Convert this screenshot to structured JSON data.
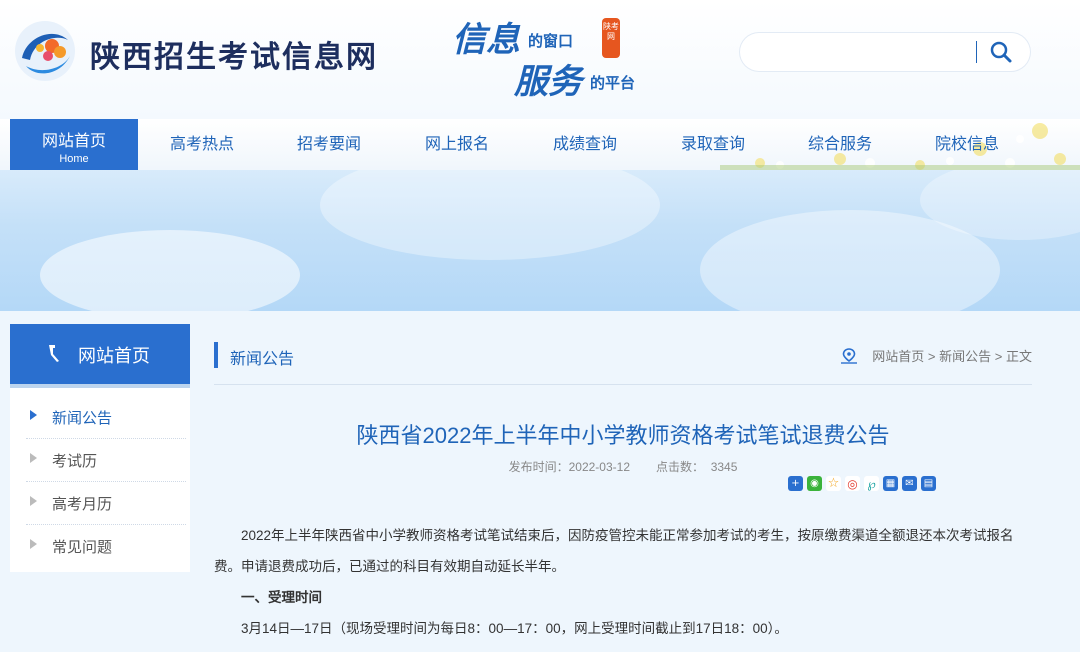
{
  "header": {
    "site_name": "陕西招生考试信息网",
    "slogan": {
      "big1": "信息",
      "small1": "的窗口",
      "big2": "服务",
      "small2": "的平台",
      "stamp": "陕考网"
    },
    "search": {
      "placeholder": "",
      "value": ""
    }
  },
  "nav": {
    "items": [
      {
        "label": "网站首页",
        "sub": "Home"
      },
      {
        "label": "高考热点"
      },
      {
        "label": "招考要闻"
      },
      {
        "label": "网上报名"
      },
      {
        "label": "成绩查询"
      },
      {
        "label": "录取查询"
      },
      {
        "label": "综合服务"
      },
      {
        "label": "院校信息"
      }
    ]
  },
  "sidebar": {
    "title": "网站首页",
    "items": [
      {
        "label": "新闻公告"
      },
      {
        "label": "考试历"
      },
      {
        "label": "高考月历"
      },
      {
        "label": "常见问题"
      }
    ]
  },
  "main": {
    "section_title": "新闻公告",
    "breadcrumb": {
      "home": "网站首页",
      "sep1": ">",
      "section": "新闻公告",
      "sep2": ">",
      "current": "正文"
    },
    "article": {
      "title": "陕西省2022年上半年中小学教师资格考试笔试退费公告",
      "publish_label": "发布时间：",
      "publish_date": "2022-03-12",
      "views_label": "点击数：",
      "views": "3345",
      "para1": "2022年上半年陕西省中小学教师资格考试笔试结束后，因防疫管控未能正常参加考试的考生，按原缴费渠道全额退还本次考试报名费。申请退费成功后，已通过的科目有效期自动延长半年。",
      "heading1": "一、受理时间",
      "para2": "3月14日—17日（现场受理时间为每日8：00—17：00，网上受理时间截止到17日18：00）。"
    }
  },
  "colors": {
    "accent": "#2a6fcf",
    "title_blue": "#1f64b8",
    "nav_blue": "#1f64b8"
  }
}
